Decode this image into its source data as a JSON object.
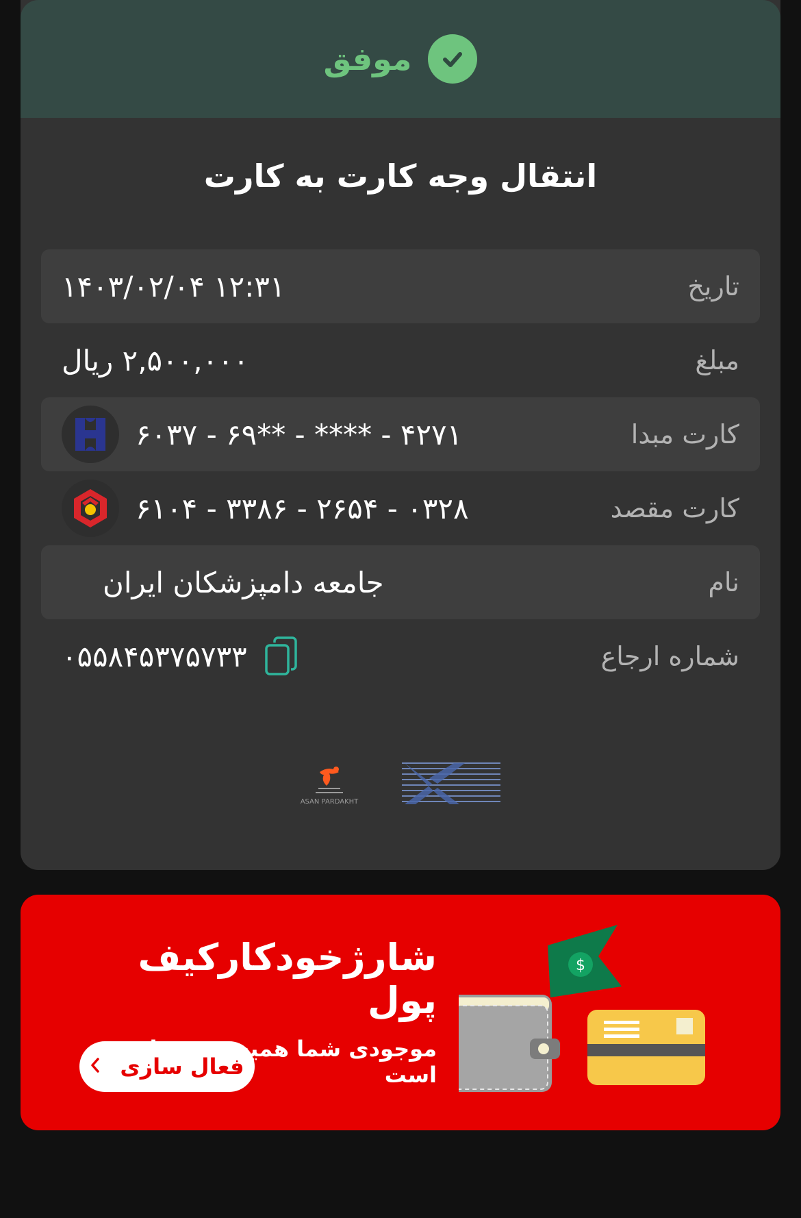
{
  "status": {
    "text": "موفق",
    "color": "#6ec47e"
  },
  "title": "انتقال وجه کارت به کارت",
  "rows": [
    {
      "label": "تاریخ",
      "value": "۱۴۰۳/۰۲/۰۴ ۱۲:۳۱"
    },
    {
      "label": "مبلغ",
      "value": "۲,۵۰۰,۰۰۰ ریال"
    },
    {
      "label": "کارت مبدا",
      "value": "۶۰۳۷ - ۶۹** - **** - ۴۲۷۱"
    },
    {
      "label": "کارت مقصد",
      "value": "۶۱۰۴ - ۳۳۸۶ - ۲۶۵۴ - ۰۳۲۸"
    },
    {
      "label": "نام",
      "value": "جامعه دامپزشکان ایران"
    },
    {
      "label": "شماره ارجاع",
      "value": "۰۵۵۸۴۵۳۷۵۷۳۳"
    }
  ],
  "icons": {
    "source_bank": "saderat-bank-logo",
    "dest_bank": "mellat-bank-logo",
    "copy": "copy-icon",
    "check": "check-icon"
  },
  "footer_logos": {
    "asan_pardakht_caption": "ASAN PARDAKHT",
    "second_logo": "shaparak-logo"
  },
  "banner": {
    "title": "شارژخودکارکیف پول",
    "subtitle": "موجودی شما همیشه برقرار است",
    "button_label": "فعال سازی",
    "background": "#e60000"
  }
}
